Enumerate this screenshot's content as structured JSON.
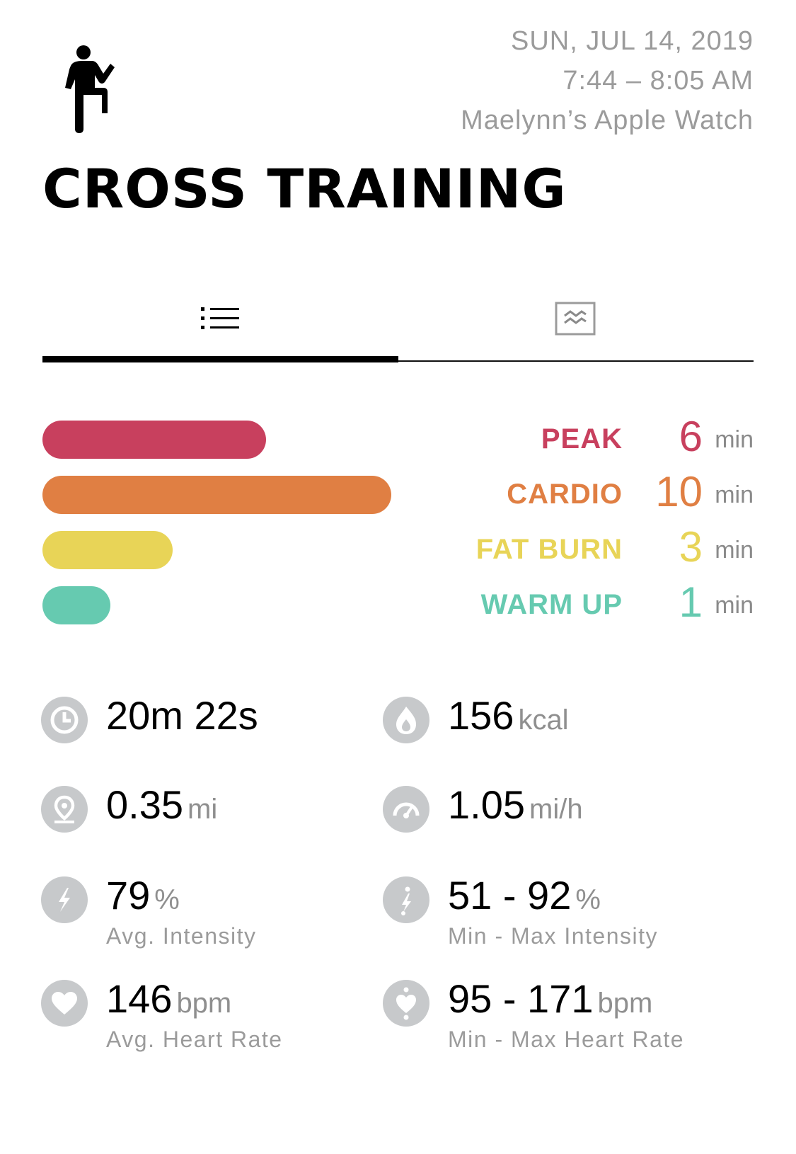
{
  "header": {
    "date": "SUN, JUL 14, 2019",
    "time_range": "7:44 – 8:05 AM",
    "device": "Maelynn’s Apple Watch",
    "activity_icon": "cross-training-figure-icon",
    "title": "CROSS TRAINING"
  },
  "tabs": [
    {
      "icon": "list-icon",
      "active": true
    },
    {
      "icon": "chart-icon",
      "active": false
    }
  ],
  "zones": [
    {
      "label": "PEAK",
      "value": "6",
      "unit": "min",
      "minutes": 6,
      "color": "#c8405e"
    },
    {
      "label": "CARDIO",
      "value": "10",
      "unit": "min",
      "minutes": 10,
      "color": "#e07f43"
    },
    {
      "label": "FAT BURN",
      "value": "3",
      "unit": "min",
      "minutes": 3,
      "color": "#e8d457"
    },
    {
      "label": "WARM UP",
      "value": "1",
      "unit": "min",
      "minutes": 1,
      "color": "#66cab0"
    }
  ],
  "stats": {
    "duration": {
      "value": "20m 22s",
      "icon": "clock-icon"
    },
    "calories": {
      "value": "156",
      "unit": "kcal",
      "icon": "flame-icon"
    },
    "distance": {
      "value": "0.35",
      "unit": "mi",
      "icon": "location-pin-icon"
    },
    "speed": {
      "value": "1.05",
      "unit": "mi/h",
      "icon": "speedometer-icon"
    },
    "avg_intensity": {
      "value": "79",
      "unit": "%",
      "caption": "Avg. Intensity",
      "icon": "lightning-icon"
    },
    "intensity_range": {
      "value": "51 - 92",
      "unit": "%",
      "caption": "Min - Max Intensity",
      "icon": "lightning-range-icon"
    },
    "avg_heart_rate": {
      "value": "146",
      "unit": "bpm",
      "caption": "Avg. Heart Rate",
      "icon": "heart-icon"
    },
    "heart_rate_range": {
      "value": "95 - 171",
      "unit": "bpm",
      "caption": "Min - Max Heart Rate",
      "icon": "heart-range-icon"
    }
  },
  "colors": {
    "meta_text": "#9b9b9b",
    "icon_circle": "#c7c9cb",
    "unit_text": "#8f8f8f"
  }
}
